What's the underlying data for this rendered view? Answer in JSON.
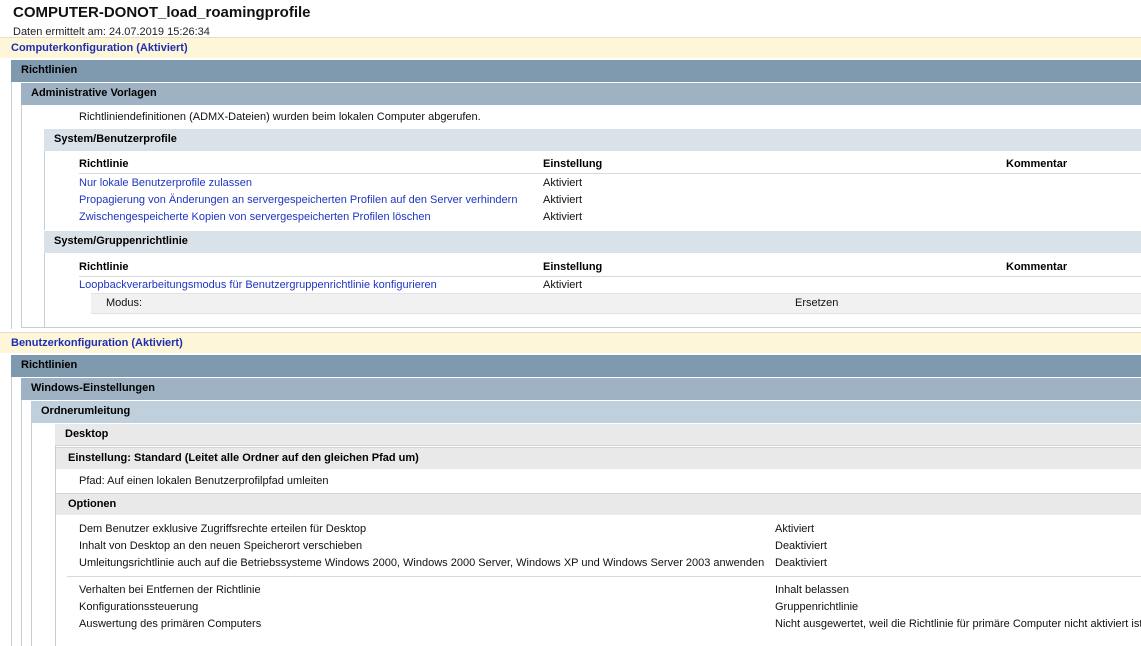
{
  "header": {
    "title": "COMPUTER-DONOT_load_roamingprofile",
    "subtitle": "Daten ermittelt am: 24.07.2019 15:26:34"
  },
  "computer": {
    "heading": "Computerkonfiguration (Aktiviert)",
    "richtlinien": "Richtlinien",
    "admin_templates": "Administrative Vorlagen",
    "admx_note": "Richtliniendefinitionen (ADMX-Dateien) wurden beim lokalen Computer abgerufen.",
    "system_profiles": {
      "title": "System/Benutzerprofile",
      "columns": [
        "Richtlinie",
        "Einstellung",
        "Kommentar"
      ],
      "rows": [
        {
          "policy": "Nur lokale Benutzerprofile zulassen",
          "setting": "Aktiviert"
        },
        {
          "policy": "Propagierung von Änderungen an servergespeicherten Profilen auf den Server verhindern",
          "setting": "Aktiviert"
        },
        {
          "policy": "Zwischengespeicherte Kopien von servergespeicherten Profilen löschen",
          "setting": "Aktiviert"
        }
      ]
    },
    "system_gp": {
      "title": "System/Gruppenrichtlinie",
      "columns": [
        "Richtlinie",
        "Einstellung",
        "Kommentar"
      ],
      "rows": [
        {
          "policy": "Loopbackverarbeitungsmodus für Benutzergruppenrichtlinie konfigurieren",
          "setting": "Aktiviert"
        }
      ],
      "mode_label": "Modus:",
      "mode_value": "Ersetzen"
    }
  },
  "user": {
    "heading": "Benutzerkonfiguration (Aktiviert)",
    "richtlinien": "Richtlinien",
    "windows_settings": "Windows-Einstellungen",
    "folder_redirection": "Ordnerumleitung",
    "desktop": "Desktop",
    "setting_title": "Einstellung: Standard (Leitet alle Ordner auf den gleichen Pfad um)",
    "path": "Pfad: Auf einen lokalen Benutzerprofilpfad umleiten",
    "options_title": "Optionen",
    "options_a": [
      {
        "label": "Dem Benutzer exklusive Zugriffsrechte erteilen für Desktop",
        "value": "Aktiviert"
      },
      {
        "label": "Inhalt von Desktop an den neuen Speicherort verschieben",
        "value": "Deaktiviert"
      },
      {
        "label": "Umleitungsrichtlinie auch auf die Betriebssysteme Windows 2000, Windows 2000 Server, Windows XP und Windows Server 2003 anwenden",
        "value": "Deaktiviert"
      }
    ],
    "options_b": [
      {
        "label": "Verhalten bei Entfernen der Richtlinie",
        "value": "Inhalt belassen"
      },
      {
        "label": "Konfigurationssteuerung",
        "value": "Gruppenrichtlinie"
      },
      {
        "label": "Auswertung des primären Computers",
        "value": "Nicht ausgewertet, weil die Richtlinie für primäre Computer nicht aktiviert ist"
      }
    ]
  }
}
